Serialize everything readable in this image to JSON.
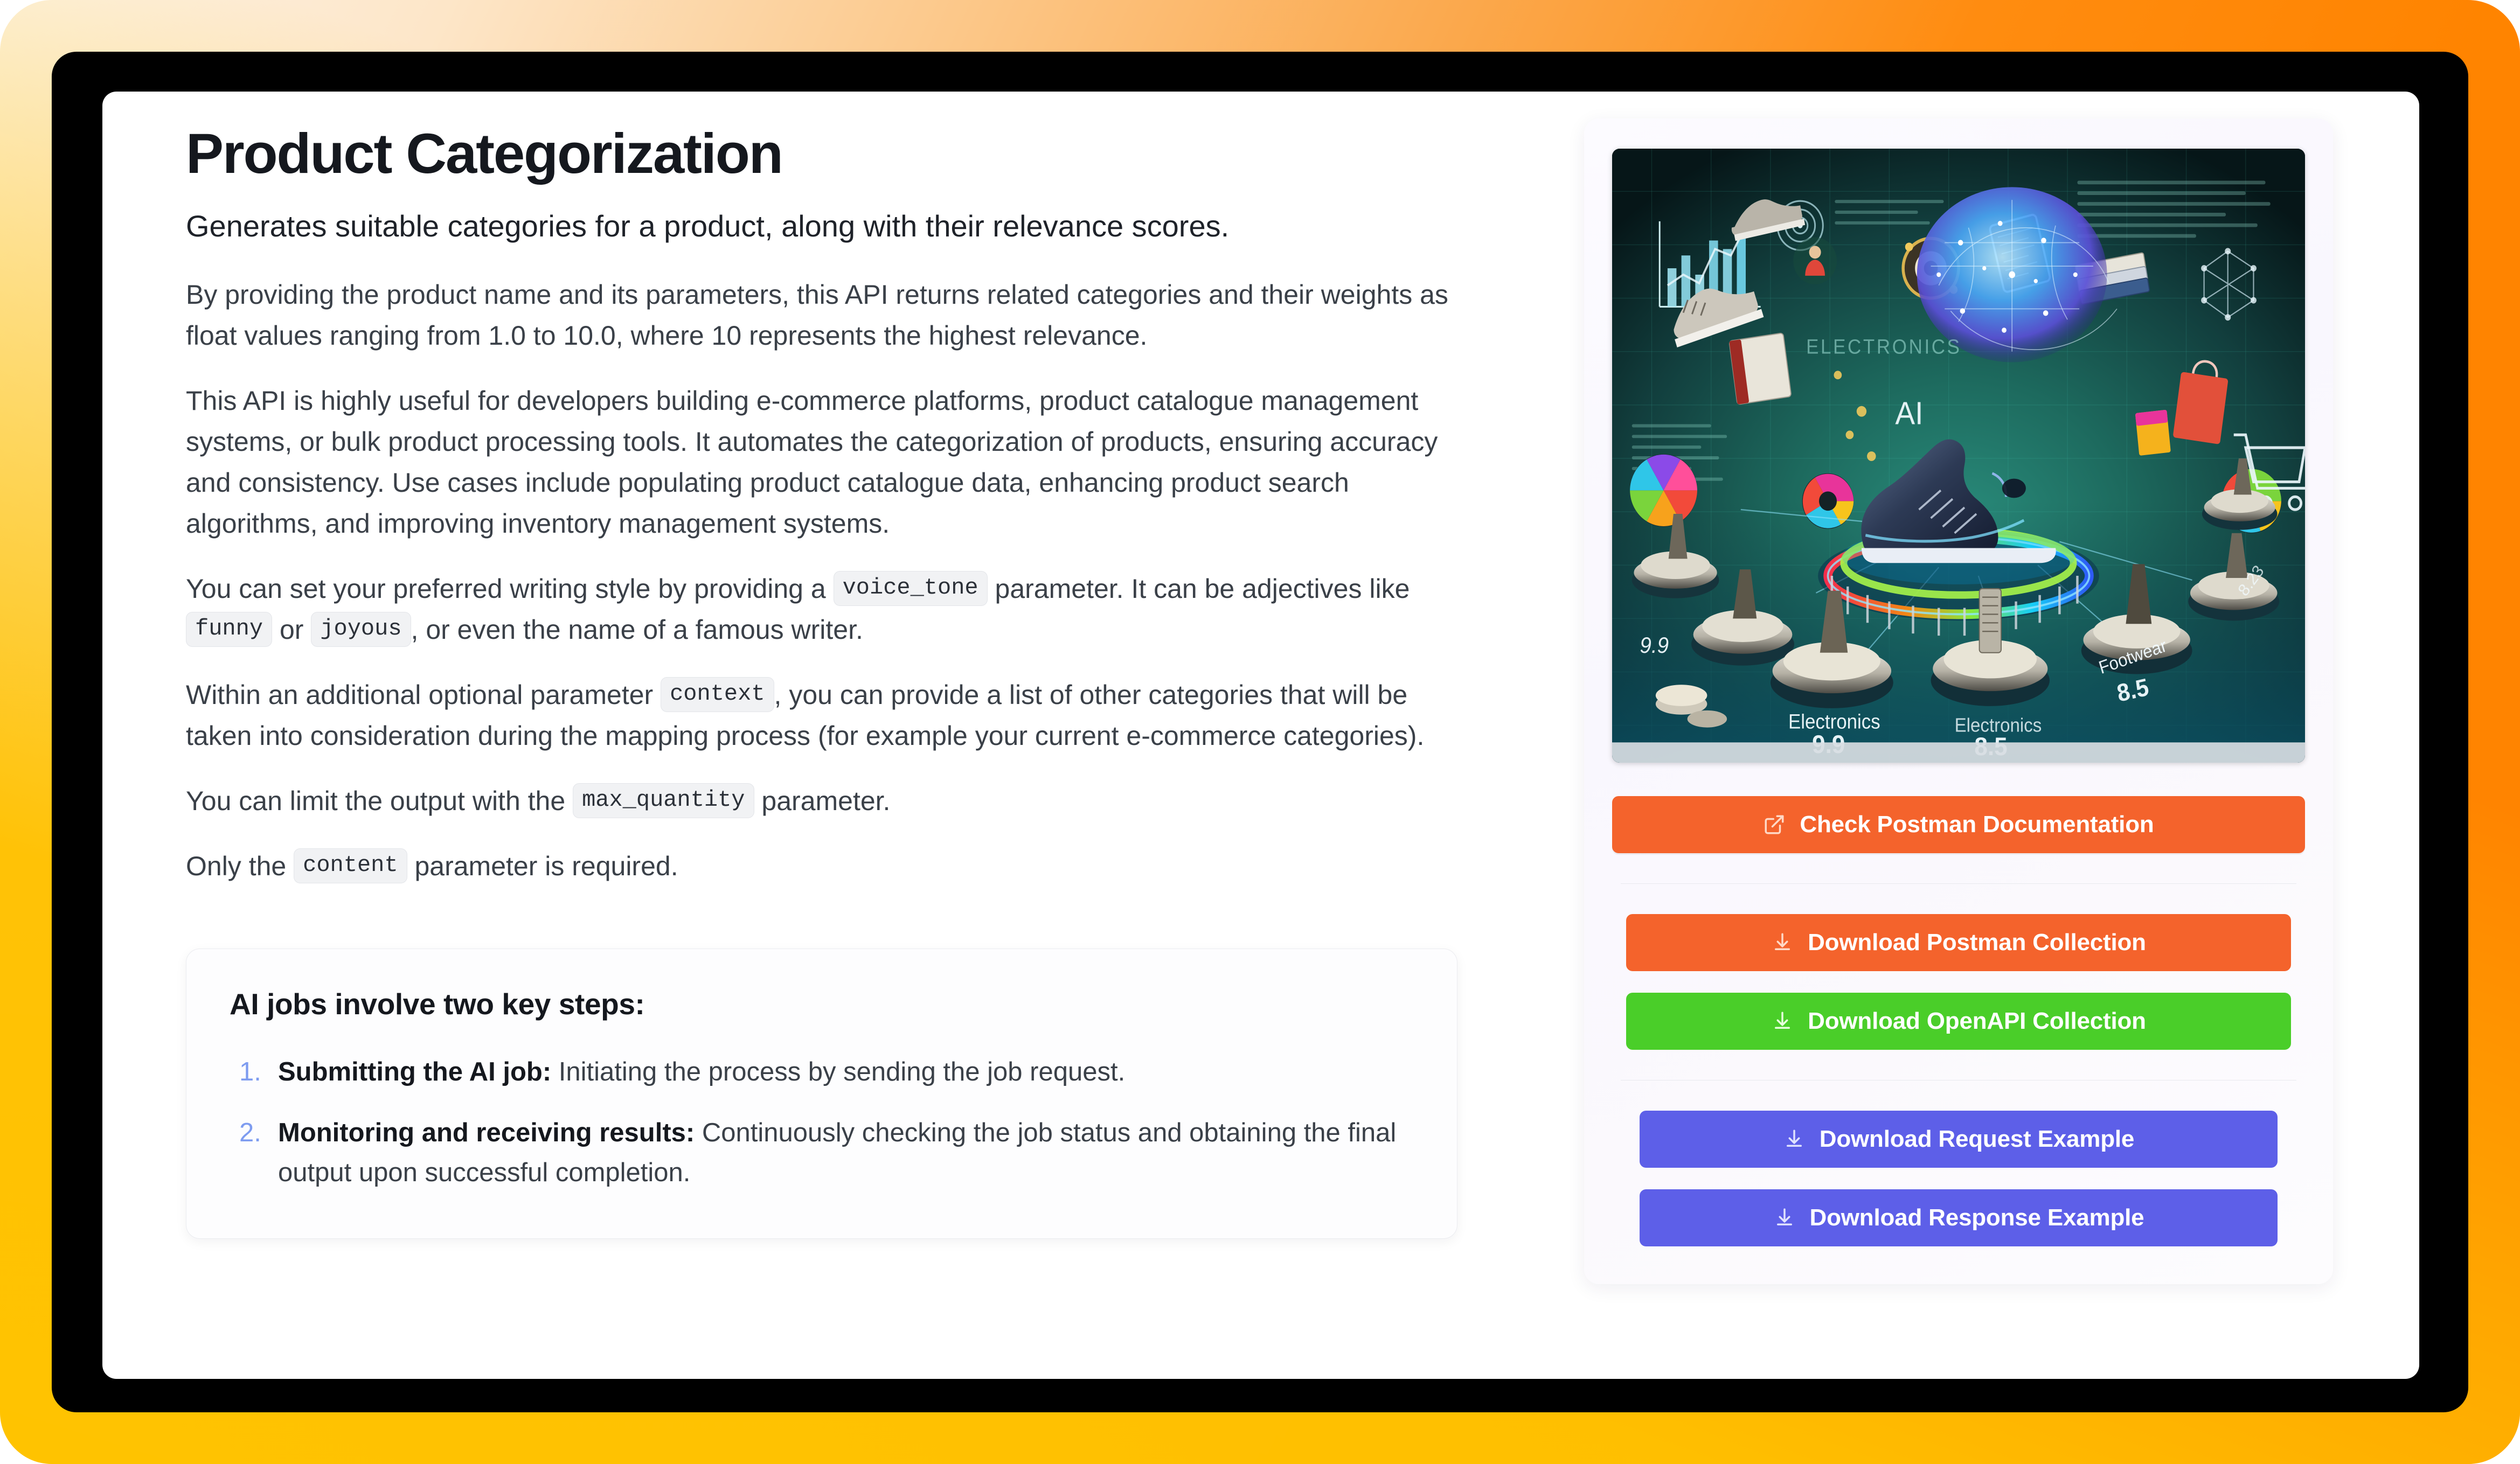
{
  "page": {
    "title": "Product Categorization",
    "lede": "Generates suitable categories for a product, along with their relevance scores.",
    "paragraphs": {
      "p1": "By providing the product name and its parameters, this API returns related categories and their weights as float values ranging from 1.0 to 10.0, where 10 represents the highest relevance.",
      "p2": "This API is highly useful for developers building e-commerce platforms, product catalogue management systems, or bulk product processing tools. It automates the categorization of products, ensuring accuracy and consistency. Use cases include populating product catalogue data, enhancing product search algorithms, and improving inventory management systems.",
      "p3_a": "You can set your preferred writing style by providing a",
      "p3_b": "parameter. It can be adjectives like",
      "p3_c": "or",
      "p3_d": ", or even the name of a famous writer.",
      "p4_a": "Within an additional optional parameter",
      "p4_b": ", you can provide a list of other categories that will be taken into consideration during the mapping process (for example your current e-commerce categories).",
      "p5_a": "You can limit the output with the",
      "p5_b": "parameter.",
      "p6_a": "Only the",
      "p6_b": "parameter is required."
    },
    "code_chips": {
      "voice_tone": "voice_tone",
      "funny": "funny",
      "joyous": "joyous",
      "context": "context",
      "max_quantity": "max_quantity",
      "content": "content"
    }
  },
  "steps_box": {
    "title": "AI jobs involve two key steps:",
    "items": [
      {
        "bold": "Submitting the AI job:",
        "rest": " Initiating the process by sending the job request."
      },
      {
        "bold": "Monitoring and receiving results:",
        "rest": " Continuously checking the job status and obtaining the final output upon successful completion."
      }
    ]
  },
  "panel": {
    "hero": {
      "alt": "AI product categorization illustration",
      "labels": {
        "ai": "AI",
        "electronics_tag": "ELECTRONICS",
        "electronics_name": "Electronics",
        "electronics_score": "9.9",
        "left_score": "9.9",
        "middle_name": "Electronics",
        "middle_score": "8.5",
        "footwear_name": "Footwear",
        "footwear_score": "8.5",
        "right_score": "8.23"
      }
    },
    "buttons": [
      {
        "id": "check-postman-documentation",
        "label": "Check Postman Documentation",
        "icon": "external-link-icon",
        "color": "#f4632c"
      },
      {
        "id": "download-postman-collection",
        "label": "Download Postman Collection",
        "icon": "download-icon",
        "color": "#f4632c"
      },
      {
        "id": "download-openapi-collection",
        "label": "Download OpenAPI Collection",
        "icon": "download-icon",
        "color": "#4ace29"
      },
      {
        "id": "download-request-example",
        "label": "Download Request Example",
        "icon": "download-icon",
        "color": "#5d5fe8"
      },
      {
        "id": "download-response-example",
        "label": "Download Response Example",
        "icon": "download-icon",
        "color": "#5d5fe8"
      }
    ]
  },
  "frame": {
    "gradient_start": "#fdf3e7",
    "gradient_mid": "#ff8c10",
    "gradient_end": "#ffc300",
    "bezel_color": "#000000"
  }
}
